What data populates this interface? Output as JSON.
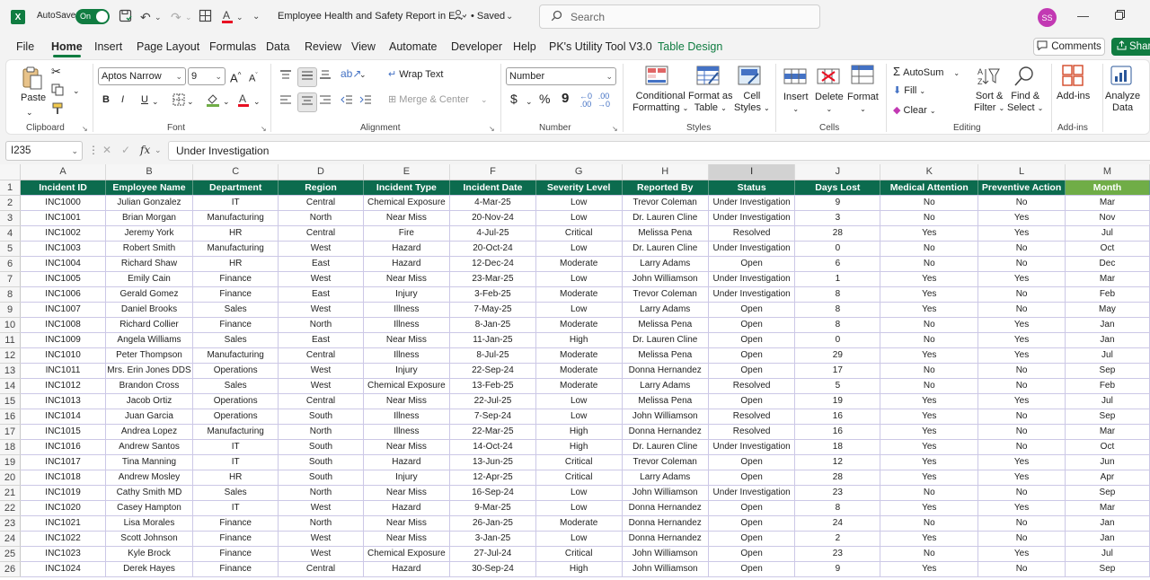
{
  "titlebar": {
    "autosave_label": "AutoSave",
    "autosave_state": "On",
    "document_title": "Employee Health and Safety Report in E...",
    "saved_status": "• Saved",
    "search_placeholder": "Search",
    "user_initials": "SS"
  },
  "menu": {
    "tabs": [
      "File",
      "Home",
      "Insert",
      "Page Layout",
      "Formulas",
      "Data",
      "Review",
      "View",
      "Automate",
      "Developer",
      "Help",
      "PK's Utility Tool V3.0",
      "Table Design"
    ],
    "active_tab": "Home",
    "comments_label": "Comments",
    "share_label": "Share"
  },
  "ribbon": {
    "clipboard": {
      "group_label": "Clipboard",
      "paste_label": "Paste"
    },
    "font": {
      "group_label": "Font",
      "font_name": "Aptos Narrow",
      "font_size": "9",
      "bold": "B",
      "italic": "I",
      "underline": "U"
    },
    "alignment": {
      "group_label": "Alignment",
      "wrap_text": "Wrap Text",
      "merge_center": "Merge & Center"
    },
    "number": {
      "group_label": "Number",
      "format": "Number",
      "currency": "$",
      "percent": "%",
      "comma": "9"
    },
    "styles": {
      "group_label": "Styles",
      "conditional_formatting_1": "Conditional",
      "conditional_formatting_2": "Formatting",
      "format_as_table_1": "Format as",
      "format_as_table_2": "Table",
      "cell_styles_1": "Cell",
      "cell_styles_2": "Styles"
    },
    "cells": {
      "group_label": "Cells",
      "insert": "Insert",
      "delete": "Delete",
      "format": "Format"
    },
    "editing": {
      "group_label": "Editing",
      "autosum": "AutoSum",
      "fill": "Fill",
      "clear": "Clear",
      "sort_filter_1": "Sort &",
      "sort_filter_2": "Filter",
      "find_select_1": "Find &",
      "find_select_2": "Select"
    },
    "addins": {
      "group_label": "Add-ins",
      "addins_label": "Add-ins",
      "analyze_1": "Analyze",
      "analyze_2": "Data"
    }
  },
  "formula_bar": {
    "name_box": "I235",
    "fx_label": "fx",
    "value": "Under Investigation"
  },
  "sheet": {
    "column_letters": [
      "A",
      "B",
      "C",
      "D",
      "E",
      "F",
      "G",
      "H",
      "I",
      "J",
      "K",
      "L",
      "M"
    ],
    "selected_column": "I",
    "headers": [
      "Incident ID",
      "Employee Name",
      "Department",
      "Region",
      "Incident Type",
      "Incident Date",
      "Severity Level",
      "Reported By",
      "Status",
      "Days Lost",
      "Medical Attention",
      "Preventive Action",
      "Month"
    ],
    "row_numbers": [
      1,
      2,
      3,
      4,
      5,
      6,
      7,
      8,
      9,
      10,
      11,
      12,
      13,
      14,
      15,
      16,
      17,
      18,
      19,
      20,
      21,
      22,
      23,
      24,
      25,
      26
    ],
    "rows": [
      [
        "INC1000",
        "Julian Gonzalez",
        "IT",
        "Central",
        "Chemical Exposure",
        "4-Mar-25",
        "Low",
        "Trevor Coleman",
        "Under Investigation",
        "9",
        "No",
        "No",
        "Mar"
      ],
      [
        "INC1001",
        "Brian Morgan",
        "Manufacturing",
        "North",
        "Near Miss",
        "20-Nov-24",
        "Low",
        "Dr. Lauren Cline",
        "Under Investigation",
        "3",
        "No",
        "Yes",
        "Nov"
      ],
      [
        "INC1002",
        "Jeremy York",
        "HR",
        "Central",
        "Fire",
        "4-Jul-25",
        "Critical",
        "Melissa Pena",
        "Resolved",
        "28",
        "Yes",
        "Yes",
        "Jul"
      ],
      [
        "INC1003",
        "Robert Smith",
        "Manufacturing",
        "West",
        "Hazard",
        "20-Oct-24",
        "Low",
        "Dr. Lauren Cline",
        "Under Investigation",
        "0",
        "No",
        "No",
        "Oct"
      ],
      [
        "INC1004",
        "Richard Shaw",
        "HR",
        "East",
        "Hazard",
        "12-Dec-24",
        "Moderate",
        "Larry Adams",
        "Open",
        "6",
        "No",
        "No",
        "Dec"
      ],
      [
        "INC1005",
        "Emily Cain",
        "Finance",
        "West",
        "Near Miss",
        "23-Mar-25",
        "Low",
        "John Williamson",
        "Under Investigation",
        "1",
        "Yes",
        "Yes",
        "Mar"
      ],
      [
        "INC1006",
        "Gerald Gomez",
        "Finance",
        "East",
        "Injury",
        "3-Feb-25",
        "Moderate",
        "Trevor Coleman",
        "Under Investigation",
        "8",
        "Yes",
        "No",
        "Feb"
      ],
      [
        "INC1007",
        "Daniel Brooks",
        "Sales",
        "West",
        "Illness",
        "7-May-25",
        "Low",
        "Larry Adams",
        "Open",
        "8",
        "Yes",
        "No",
        "May"
      ],
      [
        "INC1008",
        "Richard Collier",
        "Finance",
        "North",
        "Illness",
        "8-Jan-25",
        "Moderate",
        "Melissa Pena",
        "Open",
        "8",
        "No",
        "Yes",
        "Jan"
      ],
      [
        "INC1009",
        "Angela Williams",
        "Sales",
        "East",
        "Near Miss",
        "11-Jan-25",
        "High",
        "Dr. Lauren Cline",
        "Open",
        "0",
        "No",
        "Yes",
        "Jan"
      ],
      [
        "INC1010",
        "Peter Thompson",
        "Manufacturing",
        "Central",
        "Illness",
        "8-Jul-25",
        "Moderate",
        "Melissa Pena",
        "Open",
        "29",
        "Yes",
        "Yes",
        "Jul"
      ],
      [
        "INC1011",
        "Mrs. Erin Jones DDS",
        "Operations",
        "West",
        "Injury",
        "22-Sep-24",
        "Moderate",
        "Donna Hernandez",
        "Open",
        "17",
        "No",
        "No",
        "Sep"
      ],
      [
        "INC1012",
        "Brandon Cross",
        "Sales",
        "West",
        "Chemical Exposure",
        "13-Feb-25",
        "Moderate",
        "Larry Adams",
        "Resolved",
        "5",
        "No",
        "No",
        "Feb"
      ],
      [
        "INC1013",
        "Jacob Ortiz",
        "Operations",
        "Central",
        "Near Miss",
        "22-Jul-25",
        "Low",
        "Melissa Pena",
        "Open",
        "19",
        "Yes",
        "Yes",
        "Jul"
      ],
      [
        "INC1014",
        "Juan Garcia",
        "Operations",
        "South",
        "Illness",
        "7-Sep-24",
        "Low",
        "John Williamson",
        "Resolved",
        "16",
        "Yes",
        "No",
        "Sep"
      ],
      [
        "INC1015",
        "Andrea Lopez",
        "Manufacturing",
        "North",
        "Illness",
        "22-Mar-25",
        "High",
        "Donna Hernandez",
        "Resolved",
        "16",
        "Yes",
        "No",
        "Mar"
      ],
      [
        "INC1016",
        "Andrew Santos",
        "IT",
        "South",
        "Near Miss",
        "14-Oct-24",
        "High",
        "Dr. Lauren Cline",
        "Under Investigation",
        "18",
        "Yes",
        "No",
        "Oct"
      ],
      [
        "INC1017",
        "Tina Manning",
        "IT",
        "South",
        "Hazard",
        "13-Jun-25",
        "Critical",
        "Trevor Coleman",
        "Open",
        "12",
        "Yes",
        "Yes",
        "Jun"
      ],
      [
        "INC1018",
        "Andrew Mosley",
        "HR",
        "South",
        "Injury",
        "12-Apr-25",
        "Critical",
        "Larry Adams",
        "Open",
        "28",
        "Yes",
        "Yes",
        "Apr"
      ],
      [
        "INC1019",
        "Cathy Smith MD",
        "Sales",
        "North",
        "Near Miss",
        "16-Sep-24",
        "Low",
        "John Williamson",
        "Under Investigation",
        "23",
        "No",
        "No",
        "Sep"
      ],
      [
        "INC1020",
        "Casey Hampton",
        "IT",
        "West",
        "Hazard",
        "9-Mar-25",
        "Low",
        "Donna Hernandez",
        "Open",
        "8",
        "Yes",
        "Yes",
        "Mar"
      ],
      [
        "INC1021",
        "Lisa Morales",
        "Finance",
        "North",
        "Near Miss",
        "26-Jan-25",
        "Moderate",
        "Donna Hernandez",
        "Open",
        "24",
        "No",
        "No",
        "Jan"
      ],
      [
        "INC1022",
        "Scott Johnson",
        "Finance",
        "West",
        "Near Miss",
        "3-Jan-25",
        "Low",
        "Donna Hernandez",
        "Open",
        "2",
        "Yes",
        "No",
        "Jan"
      ],
      [
        "INC1023",
        "Kyle Brock",
        "Finance",
        "West",
        "Chemical Exposure",
        "27-Jul-24",
        "Critical",
        "John Williamson",
        "Open",
        "23",
        "No",
        "Yes",
        "Jul"
      ],
      [
        "INC1024",
        "Derek Hayes",
        "Finance",
        "Central",
        "Hazard",
        "30-Sep-24",
        "High",
        "John Williamson",
        "Open",
        "9",
        "Yes",
        "No",
        "Sep"
      ]
    ]
  },
  "icons": {
    "excel": "excel-logo-icon",
    "save": "save-icon",
    "undo": "undo-icon",
    "redo": "redo-icon",
    "search": "search-icon"
  },
  "colors": {
    "header_fill": "#0c6b4e",
    "month_header_fill": "#70ad47",
    "accent": "#107c41"
  }
}
